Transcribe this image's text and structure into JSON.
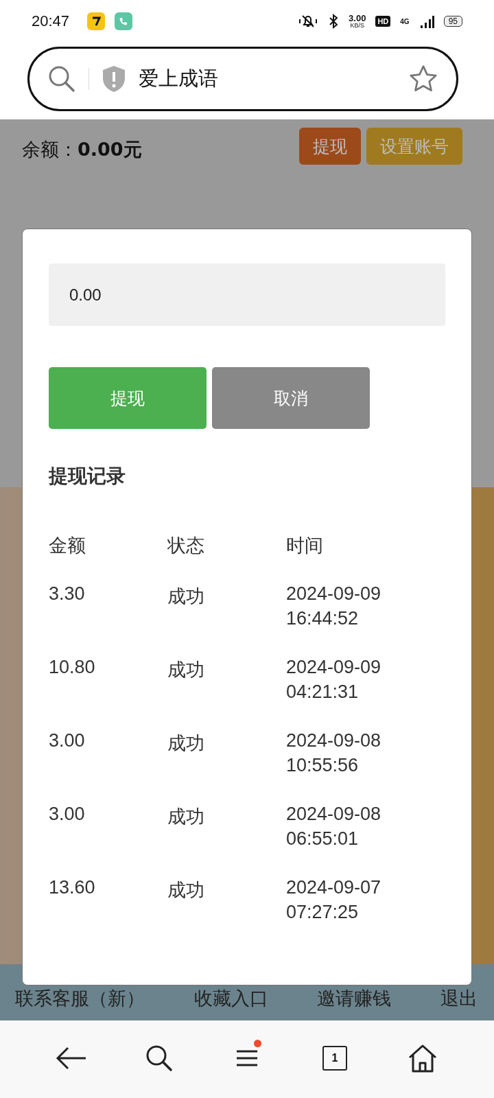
{
  "status_bar": {
    "time": "20:47",
    "net_speed": "3.00",
    "net_unit": "KB/S",
    "hd": "HD",
    "network": "4G",
    "battery": "95"
  },
  "address_bar": {
    "title": "爱上成语"
  },
  "balance": {
    "label": "余额：",
    "value": "0.00元"
  },
  "actions": [
    {
      "label": "提现",
      "color": "#9c4a1a"
    },
    {
      "label": "设置账号",
      "color": "#a07a1e"
    }
  ],
  "dialog": {
    "amount_field": {
      "value": "0.00"
    },
    "buttons": [
      {
        "label": "提现",
        "kind": "primary"
      },
      {
        "label": "取消",
        "kind": "secondary"
      }
    ],
    "records_title": "提现记录",
    "table": {
      "columns": [
        "金额",
        "状态",
        "时间"
      ],
      "rows": [
        [
          "3.30",
          "成功",
          "2024-09-09 16:44:52"
        ],
        [
          "10.80",
          "成功",
          "2024-09-09 04:21:31"
        ],
        [
          "3.00",
          "成功",
          "2024-09-08 10:55:56"
        ],
        [
          "3.00",
          "成功",
          "2024-09-08 06:55:01"
        ],
        [
          "13.60",
          "成功",
          "2024-09-07 07:27:25"
        ]
      ]
    }
  },
  "footer_links": [
    "联系客服（新）",
    "收藏入口",
    "邀请赚钱",
    "退出"
  ],
  "bottom_nav": {
    "tab_count": "1"
  }
}
